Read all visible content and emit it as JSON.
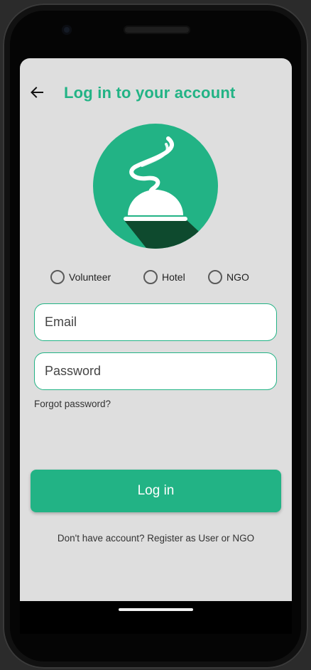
{
  "header": {
    "title": "Log in to your account",
    "back_icon": "arrow-left-icon"
  },
  "logo": {
    "icon": "serving-cloche-steam-icon",
    "circle_color": "#22b385",
    "shadow_color": "#0e4a2e"
  },
  "role_options": [
    {
      "label": "Volunteer",
      "selected": false
    },
    {
      "label": "Hotel",
      "selected": false
    },
    {
      "label": "NGO",
      "selected": false
    }
  ],
  "form": {
    "email_placeholder": "Email",
    "password_placeholder": "Password",
    "forgot_password": "Forgot password?"
  },
  "actions": {
    "login_label": "Log in",
    "register_text": "Don't have account? Register as User or NGO"
  },
  "colors": {
    "accent": "#22b385",
    "screen_bg": "#dedede"
  }
}
